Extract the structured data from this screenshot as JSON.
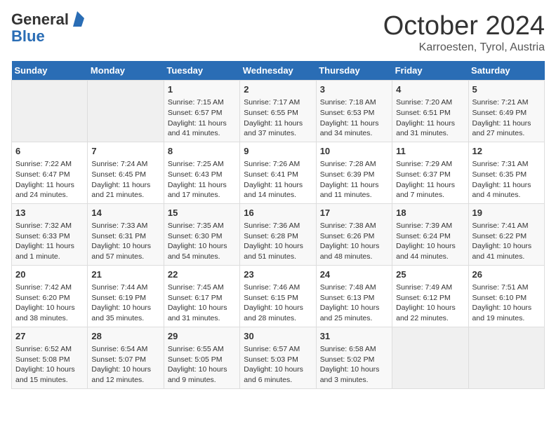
{
  "header": {
    "logo_general": "General",
    "logo_blue": "Blue",
    "month_title": "October 2024",
    "location": "Karroesten, Tyrol, Austria"
  },
  "days_of_week": [
    "Sunday",
    "Monday",
    "Tuesday",
    "Wednesday",
    "Thursday",
    "Friday",
    "Saturday"
  ],
  "weeks": [
    [
      {
        "day": "",
        "content": ""
      },
      {
        "day": "",
        "content": ""
      },
      {
        "day": "1",
        "content": "Sunrise: 7:15 AM\nSunset: 6:57 PM\nDaylight: 11 hours and 41 minutes."
      },
      {
        "day": "2",
        "content": "Sunrise: 7:17 AM\nSunset: 6:55 PM\nDaylight: 11 hours and 37 minutes."
      },
      {
        "day": "3",
        "content": "Sunrise: 7:18 AM\nSunset: 6:53 PM\nDaylight: 11 hours and 34 minutes."
      },
      {
        "day": "4",
        "content": "Sunrise: 7:20 AM\nSunset: 6:51 PM\nDaylight: 11 hours and 31 minutes."
      },
      {
        "day": "5",
        "content": "Sunrise: 7:21 AM\nSunset: 6:49 PM\nDaylight: 11 hours and 27 minutes."
      }
    ],
    [
      {
        "day": "6",
        "content": "Sunrise: 7:22 AM\nSunset: 6:47 PM\nDaylight: 11 hours and 24 minutes."
      },
      {
        "day": "7",
        "content": "Sunrise: 7:24 AM\nSunset: 6:45 PM\nDaylight: 11 hours and 21 minutes."
      },
      {
        "day": "8",
        "content": "Sunrise: 7:25 AM\nSunset: 6:43 PM\nDaylight: 11 hours and 17 minutes."
      },
      {
        "day": "9",
        "content": "Sunrise: 7:26 AM\nSunset: 6:41 PM\nDaylight: 11 hours and 14 minutes."
      },
      {
        "day": "10",
        "content": "Sunrise: 7:28 AM\nSunset: 6:39 PM\nDaylight: 11 hours and 11 minutes."
      },
      {
        "day": "11",
        "content": "Sunrise: 7:29 AM\nSunset: 6:37 PM\nDaylight: 11 hours and 7 minutes."
      },
      {
        "day": "12",
        "content": "Sunrise: 7:31 AM\nSunset: 6:35 PM\nDaylight: 11 hours and 4 minutes."
      }
    ],
    [
      {
        "day": "13",
        "content": "Sunrise: 7:32 AM\nSunset: 6:33 PM\nDaylight: 11 hours and 1 minute."
      },
      {
        "day": "14",
        "content": "Sunrise: 7:33 AM\nSunset: 6:31 PM\nDaylight: 10 hours and 57 minutes."
      },
      {
        "day": "15",
        "content": "Sunrise: 7:35 AM\nSunset: 6:30 PM\nDaylight: 10 hours and 54 minutes."
      },
      {
        "day": "16",
        "content": "Sunrise: 7:36 AM\nSunset: 6:28 PM\nDaylight: 10 hours and 51 minutes."
      },
      {
        "day": "17",
        "content": "Sunrise: 7:38 AM\nSunset: 6:26 PM\nDaylight: 10 hours and 48 minutes."
      },
      {
        "day": "18",
        "content": "Sunrise: 7:39 AM\nSunset: 6:24 PM\nDaylight: 10 hours and 44 minutes."
      },
      {
        "day": "19",
        "content": "Sunrise: 7:41 AM\nSunset: 6:22 PM\nDaylight: 10 hours and 41 minutes."
      }
    ],
    [
      {
        "day": "20",
        "content": "Sunrise: 7:42 AM\nSunset: 6:20 PM\nDaylight: 10 hours and 38 minutes."
      },
      {
        "day": "21",
        "content": "Sunrise: 7:44 AM\nSunset: 6:19 PM\nDaylight: 10 hours and 35 minutes."
      },
      {
        "day": "22",
        "content": "Sunrise: 7:45 AM\nSunset: 6:17 PM\nDaylight: 10 hours and 31 minutes."
      },
      {
        "day": "23",
        "content": "Sunrise: 7:46 AM\nSunset: 6:15 PM\nDaylight: 10 hours and 28 minutes."
      },
      {
        "day": "24",
        "content": "Sunrise: 7:48 AM\nSunset: 6:13 PM\nDaylight: 10 hours and 25 minutes."
      },
      {
        "day": "25",
        "content": "Sunrise: 7:49 AM\nSunset: 6:12 PM\nDaylight: 10 hours and 22 minutes."
      },
      {
        "day": "26",
        "content": "Sunrise: 7:51 AM\nSunset: 6:10 PM\nDaylight: 10 hours and 19 minutes."
      }
    ],
    [
      {
        "day": "27",
        "content": "Sunrise: 6:52 AM\nSunset: 5:08 PM\nDaylight: 10 hours and 15 minutes."
      },
      {
        "day": "28",
        "content": "Sunrise: 6:54 AM\nSunset: 5:07 PM\nDaylight: 10 hours and 12 minutes."
      },
      {
        "day": "29",
        "content": "Sunrise: 6:55 AM\nSunset: 5:05 PM\nDaylight: 10 hours and 9 minutes."
      },
      {
        "day": "30",
        "content": "Sunrise: 6:57 AM\nSunset: 5:03 PM\nDaylight: 10 hours and 6 minutes."
      },
      {
        "day": "31",
        "content": "Sunrise: 6:58 AM\nSunset: 5:02 PM\nDaylight: 10 hours and 3 minutes."
      },
      {
        "day": "",
        "content": ""
      },
      {
        "day": "",
        "content": ""
      }
    ]
  ]
}
